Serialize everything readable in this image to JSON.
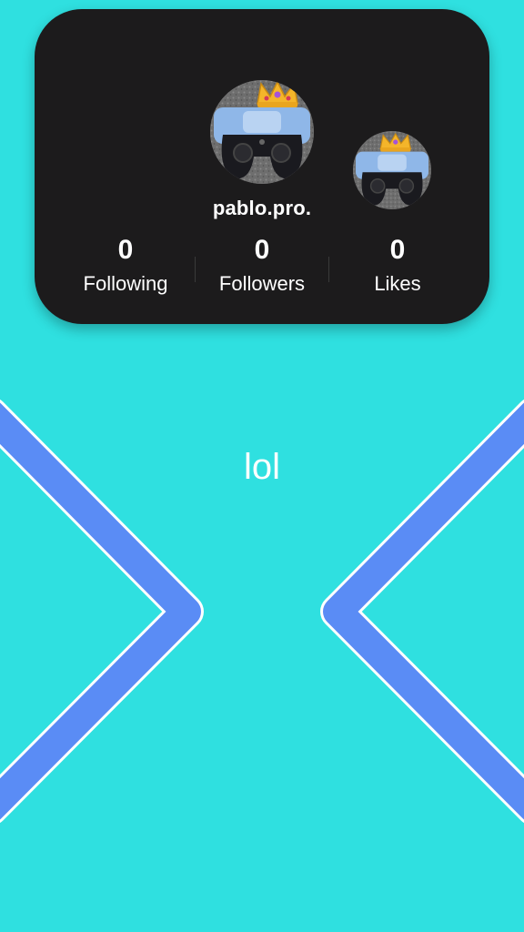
{
  "profile": {
    "username": "pablo.pro.",
    "avatar_badge_icon": "crown-icon",
    "avatar_subject": "game-controller"
  },
  "stats": [
    {
      "value": "0",
      "label": "Following"
    },
    {
      "value": "0",
      "label": "Followers"
    },
    {
      "value": "0",
      "label": "Likes"
    }
  ],
  "main": {
    "text": "lol"
  },
  "colors": {
    "background": "#2fe0e0",
    "card": "#1c1b1c",
    "chevron_stroke": "#5a8cf5",
    "chevron_outline": "#ffffff"
  }
}
